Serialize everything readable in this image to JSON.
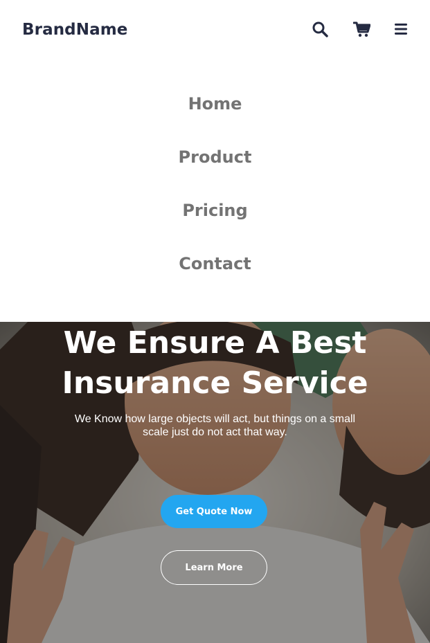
{
  "header": {
    "brand": "BrandName",
    "icons": {
      "search": "search-icon",
      "cart": "shopping-cart-icon",
      "menu": "hamburger-menu-icon"
    }
  },
  "nav": {
    "items": [
      {
        "label": "Home"
      },
      {
        "label": "Product"
      },
      {
        "label": "Pricing"
      },
      {
        "label": "Contact"
      }
    ]
  },
  "hero": {
    "title_line1": "We Ensure A Best",
    "title_line2": "Insurance Service",
    "subtitle": "We Know how large objects will act, but things on a small scale just do not act that way.",
    "primary_button": "Get Quote Now",
    "secondary_button": "Learn More"
  },
  "colors": {
    "brand_text": "#252B42",
    "nav_text": "#737373",
    "primary": "#23A6F0",
    "white": "#FFFFFF"
  }
}
